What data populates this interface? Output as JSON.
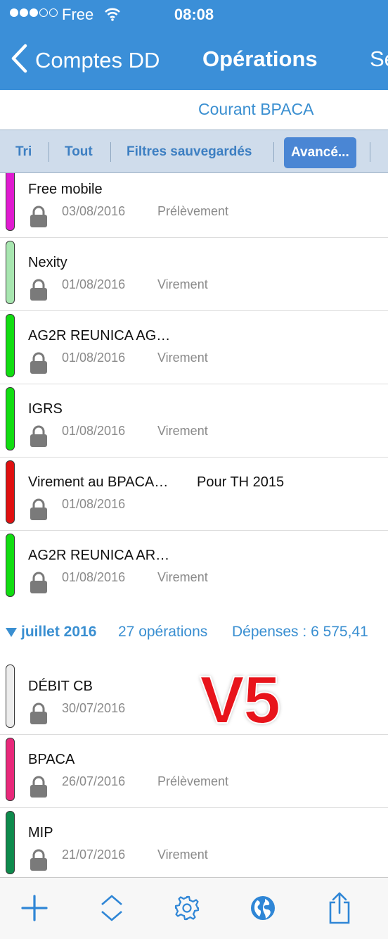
{
  "status_bar": {
    "carrier": "Free",
    "time": "08:08"
  },
  "nav": {
    "back_label": "Comptes DD",
    "title": "Opérations",
    "next_label": "Se"
  },
  "account": {
    "name": "Courant BPACA"
  },
  "filters": {
    "sort": "Tri",
    "all": "Tout",
    "saved": "Filtres sauvegardés",
    "advanced": "Avancé..."
  },
  "transactions_aug": [
    {
      "title": "Free mobile",
      "note": "",
      "date": "03/08/2016",
      "type": "Prélèvement",
      "color": "#e01bd0"
    },
    {
      "title": "Nexity",
      "note": "",
      "date": "01/08/2016",
      "type": "Virement",
      "color": "#a8e6b0"
    },
    {
      "title": "AG2R REUNICA AG…",
      "note": "",
      "date": "01/08/2016",
      "type": "Virement",
      "color": "#11dd11"
    },
    {
      "title": "IGRS",
      "note": "",
      "date": "01/08/2016",
      "type": "Virement",
      "color": "#11dd11"
    },
    {
      "title": "Virement au BPACA…",
      "note": "Pour TH 2015",
      "date": "01/08/2016",
      "type": "",
      "color": "#e01010"
    },
    {
      "title": "AG2R REUNICA AR…",
      "note": "",
      "date": "01/08/2016",
      "type": "Virement",
      "color": "#11dd11"
    }
  ],
  "section": {
    "month": "juillet 2016",
    "count": "27 opérations",
    "spend": "Dépenses : 6 575,41"
  },
  "transactions_jul": [
    {
      "title": "DÉBIT CB",
      "note": "",
      "date": "30/07/2016",
      "type": "",
      "color": "#ededed"
    },
    {
      "title": "BPACA",
      "note": "",
      "date": "26/07/2016",
      "type": "Prélèvement",
      "color": "#e8287a"
    },
    {
      "title": "MIP",
      "note": "",
      "date": "21/07/2016",
      "type": "Virement",
      "color": "#0e8a4c"
    }
  ],
  "overlay": {
    "stamp": "V5"
  },
  "toolbar": {
    "icons": [
      "plus-icon",
      "sort-icon",
      "gear-icon",
      "globe-icon",
      "share-icon"
    ]
  }
}
